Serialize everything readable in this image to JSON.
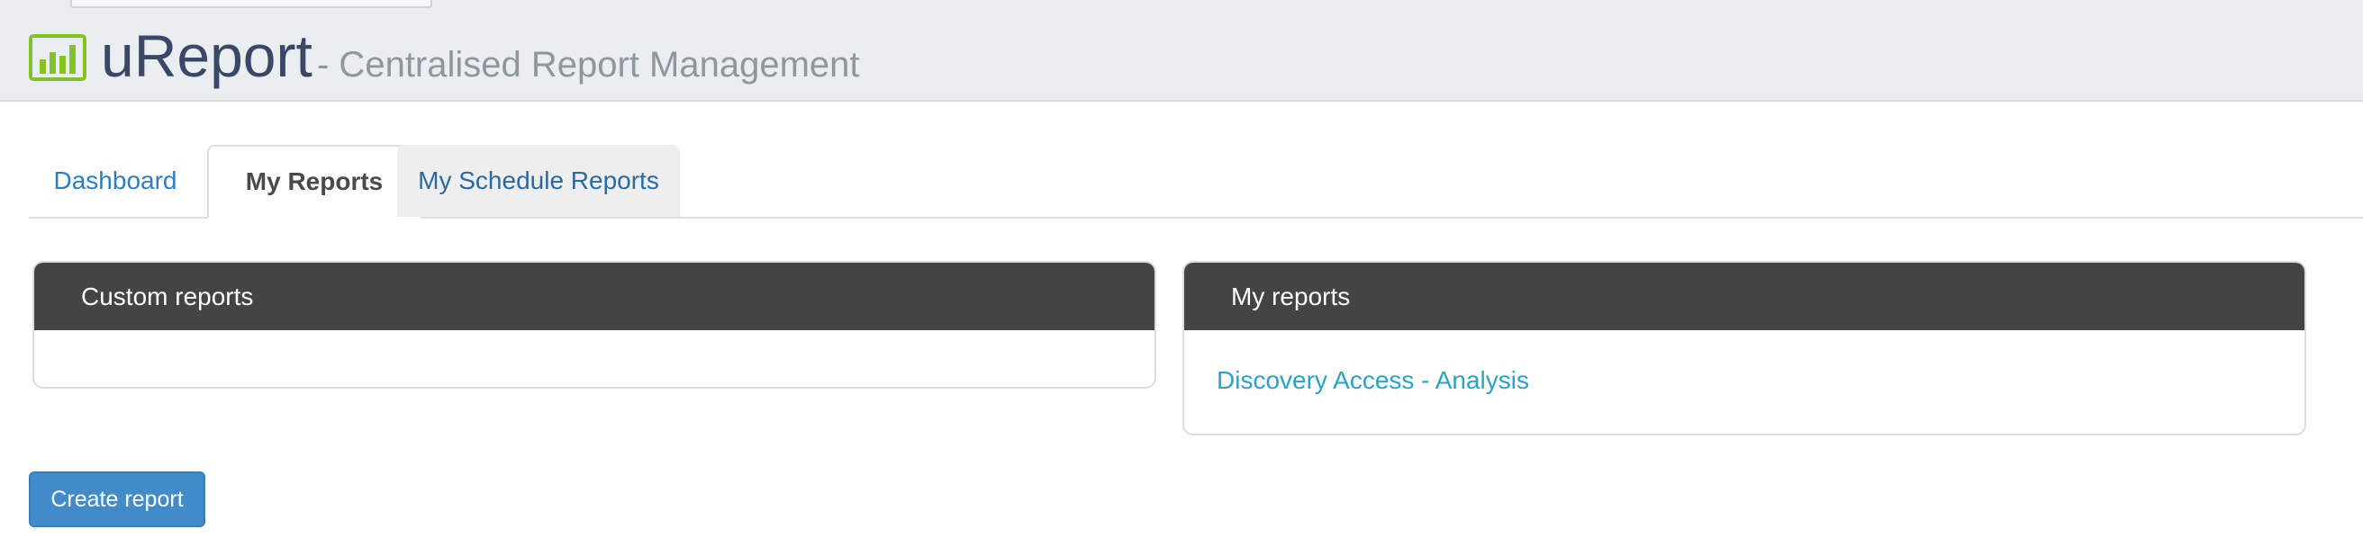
{
  "app": {
    "name": "uReport",
    "subtitle": "- Centralised Report Management",
    "logo_icon": "bar-chart-icon",
    "brand_color": "#84c225"
  },
  "tabs": [
    {
      "label": "Dashboard",
      "active": false
    },
    {
      "label": "My Reports",
      "active": true
    },
    {
      "label": "My Schedule Reports",
      "active": false
    }
  ],
  "panels": {
    "custom_reports": {
      "title": "Custom reports",
      "items": []
    },
    "my_reports": {
      "title": "My reports",
      "items": [
        {
          "label": "Discovery Access - Analysis"
        }
      ]
    }
  },
  "actions": {
    "create_report_label": "Create report"
  },
  "colors": {
    "header_bg": "#ebeef0",
    "panel_head_bg": "#444444",
    "link": "#2aa2c9",
    "primary_button": "#428bca"
  }
}
